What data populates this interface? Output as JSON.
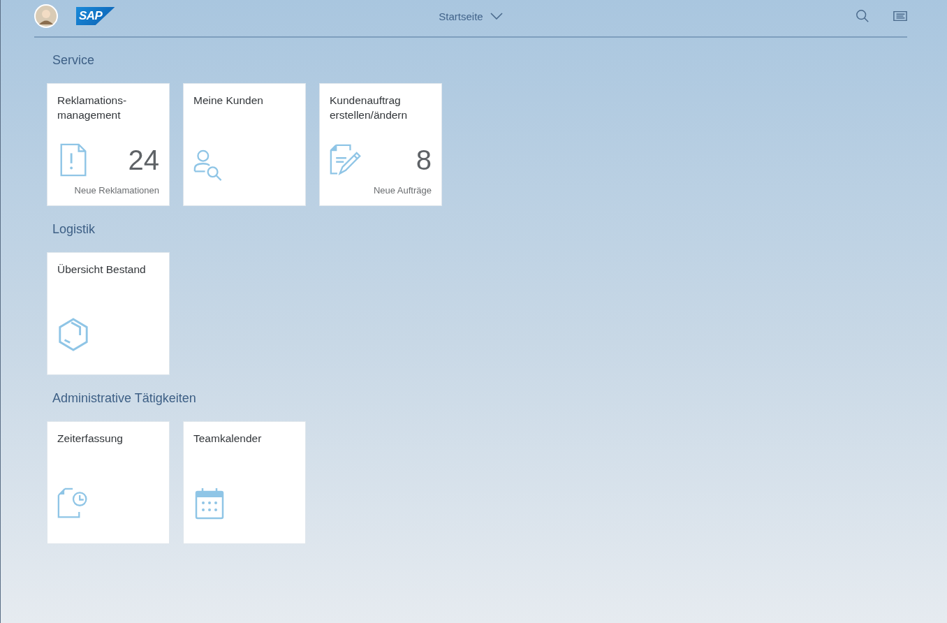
{
  "header": {
    "logo": "SAP",
    "title": "Startseite"
  },
  "groups": [
    {
      "title": "Service",
      "tiles": [
        {
          "title": "Reklamations-\nmanagement",
          "number": "24",
          "footer": "Neue Reklamationen"
        },
        {
          "title": "Meine Kunden"
        },
        {
          "title": "Kundenauftrag\nerstellen/ändern",
          "number": "8",
          "footer": "Neue Aufträge"
        }
      ]
    },
    {
      "title": "Logistik",
      "tiles": [
        {
          "title": "Übersicht Bestand"
        }
      ]
    },
    {
      "title": "Administrative Tätigkeiten",
      "tiles": [
        {
          "title": "Zeiterfassung"
        },
        {
          "title": "Teamkalender"
        }
      ]
    }
  ]
}
